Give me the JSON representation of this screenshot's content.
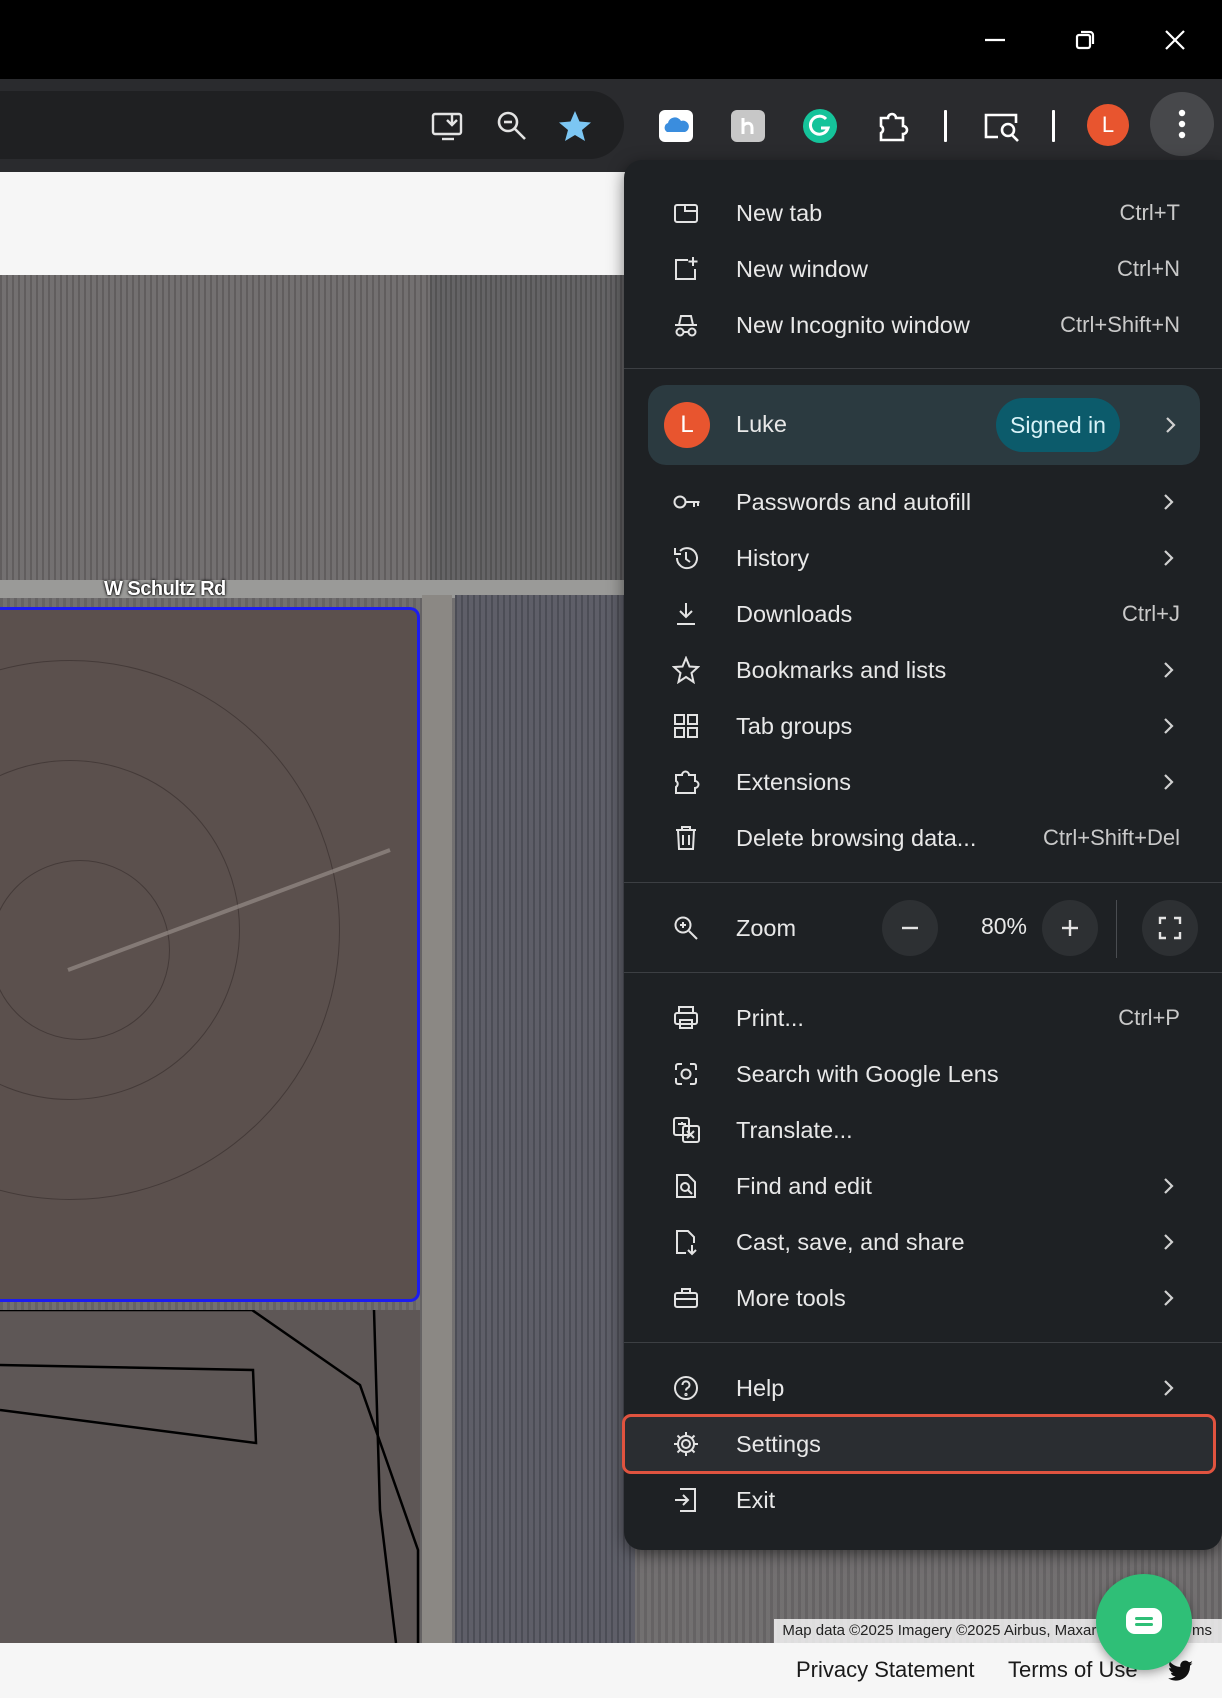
{
  "window_controls": {
    "minimize": "minimize-icon",
    "restore": "restore-icon",
    "close": "close-icon"
  },
  "toolbar": {
    "icons": [
      "install-app-icon",
      "zoom-icon",
      "bookmark-star-icon",
      "icloud-extension-icon",
      "honey-extension-icon",
      "grammarly-extension-icon",
      "extensions-puzzle-icon",
      "tab-search-icon",
      "profile-avatar",
      "more-menu-icon"
    ],
    "avatar_letter": "L"
  },
  "map": {
    "road_label": "W Schultz Rd",
    "attribution": "Map data ©2025 Imagery ©2025 Airbus, Maxar Technologies",
    "attribution_tail": "ms"
  },
  "footer": {
    "privacy": "Privacy Statement",
    "terms": "Terms of Use"
  },
  "menu": {
    "new_tab": {
      "label": "New tab",
      "shortcut": "Ctrl+T"
    },
    "new_window": {
      "label": "New window",
      "shortcut": "Ctrl+N"
    },
    "new_incognito": {
      "label": "New Incognito window",
      "shortcut": "Ctrl+Shift+N"
    },
    "profile": {
      "avatar": "L",
      "name": "Luke",
      "status": "Signed in"
    },
    "passwords": {
      "label": "Passwords and autofill"
    },
    "history": {
      "label": "History"
    },
    "downloads": {
      "label": "Downloads",
      "shortcut": "Ctrl+J"
    },
    "bookmarks": {
      "label": "Bookmarks and lists"
    },
    "tab_groups": {
      "label": "Tab groups"
    },
    "extensions": {
      "label": "Extensions"
    },
    "delete_data": {
      "label": "Delete browsing data...",
      "shortcut": "Ctrl+Shift+Del"
    },
    "zoom": {
      "label": "Zoom",
      "value": "80%"
    },
    "print": {
      "label": "Print...",
      "shortcut": "Ctrl+P"
    },
    "lens": {
      "label": "Search with Google Lens"
    },
    "translate": {
      "label": "Translate..."
    },
    "find_edit": {
      "label": "Find and edit"
    },
    "cast": {
      "label": "Cast, save, and share"
    },
    "more_tools": {
      "label": "More tools"
    },
    "help": {
      "label": "Help"
    },
    "settings": {
      "label": "Settings"
    },
    "exit": {
      "label": "Exit"
    }
  },
  "colors": {
    "highlight": "#e0533f",
    "avatar": "#e8552f",
    "signed_in_badge": "#0c5b6b",
    "menu_bg": "#1e2124"
  }
}
